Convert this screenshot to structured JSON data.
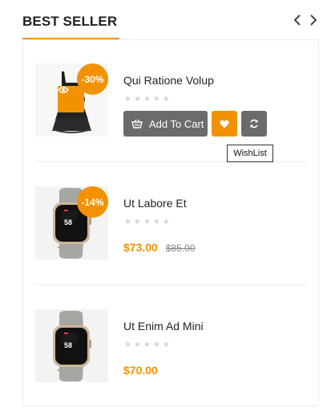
{
  "header": {
    "title": "BEST SELLER",
    "prev_icon": "chevron-left-icon",
    "next_icon": "chevron-right-icon"
  },
  "colors": {
    "accent": "#f39200",
    "button_gray": "#6b6b6b",
    "star_empty": "#d4d4d4"
  },
  "products": [
    {
      "name": "Qui Ratione Volup",
      "discount": "-30%",
      "rating": 0,
      "image": "black-top-image",
      "actions": {
        "add_to_cart": "Add To Cart",
        "wishlist_icon": "heart-icon",
        "compare_icon": "refresh-icon",
        "quick_view_icon": "eye-icon"
      },
      "tooltip": "WishList"
    },
    {
      "name": "Ut Labore Et",
      "discount": "-14%",
      "rating": 0,
      "image": "smartwatch-image",
      "price": "$73.00",
      "old_price": "$85.00"
    },
    {
      "name": "Ut Enim Ad Mini",
      "rating": 0,
      "image": "smartwatch-image",
      "price": "$70.00"
    }
  ]
}
